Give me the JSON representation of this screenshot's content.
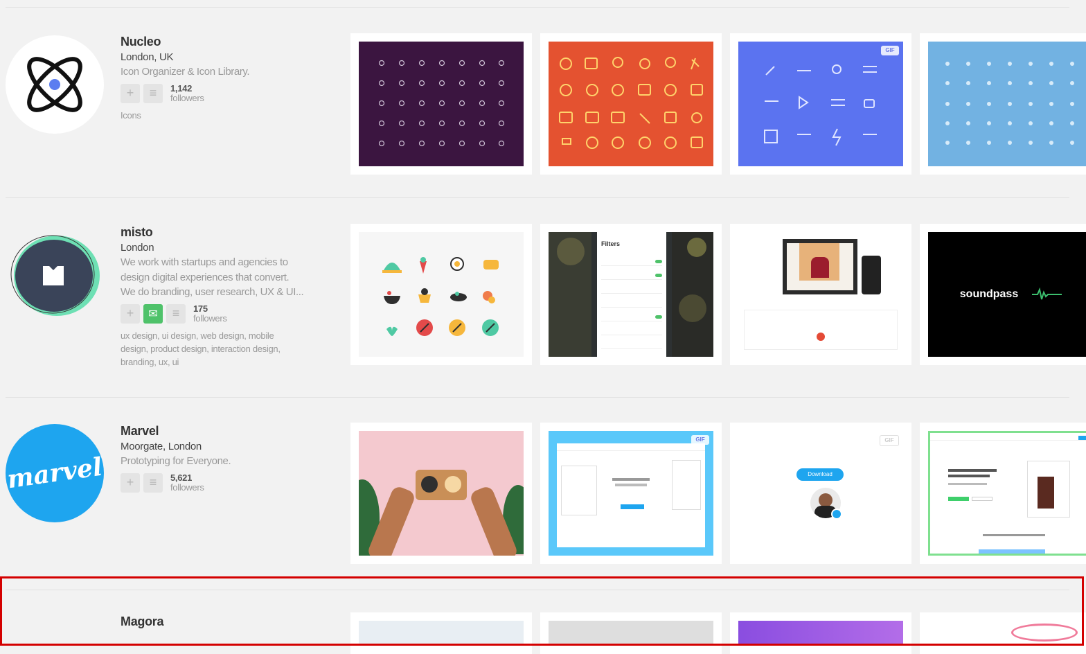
{
  "designers": [
    {
      "name": "Nucleo",
      "location": "London, UK",
      "description": [
        "Icon Organizer & Icon Library."
      ],
      "followers_count": "1,142",
      "followers_label": "followers",
      "tags": [
        "Icons"
      ]
    },
    {
      "name": "misto",
      "location": "London",
      "description": [
        "We work with startups and agencies to",
        "design digital experiences that convert.",
        "We do branding, user research, UX & UI..."
      ],
      "followers_count": "175",
      "followers_label": "followers",
      "tags": [
        "ux design, ui design, web design, mobile",
        "design, product design, interaction design,",
        "branding, ux, ui"
      ],
      "shot_texts": {
        "filters": "Filters",
        "soundpass": "soundpass"
      }
    },
    {
      "name": "Marvel",
      "location": "Moorgate, London",
      "description": [
        "Prototyping for Everyone."
      ],
      "followers_count": "5,621",
      "followers_label": "followers",
      "logo_text": "marvel",
      "shot_texts": {
        "download": "Download"
      }
    },
    {
      "name": "Magora"
    }
  ],
  "gif_badge": "GIF",
  "icons": {
    "add": "plus-icon",
    "list": "list-icon",
    "message": "mail-icon"
  },
  "colors": {
    "nucleo_dark": "#3b1540",
    "nucleo_orange": "#e45230",
    "nucleo_blue": "#5b73f0",
    "nucleo_lightblue": "#72b2e2",
    "marvel_blue": "#1ea5ef",
    "misto_navy": "#3a4459",
    "highlight": "#d40000"
  }
}
